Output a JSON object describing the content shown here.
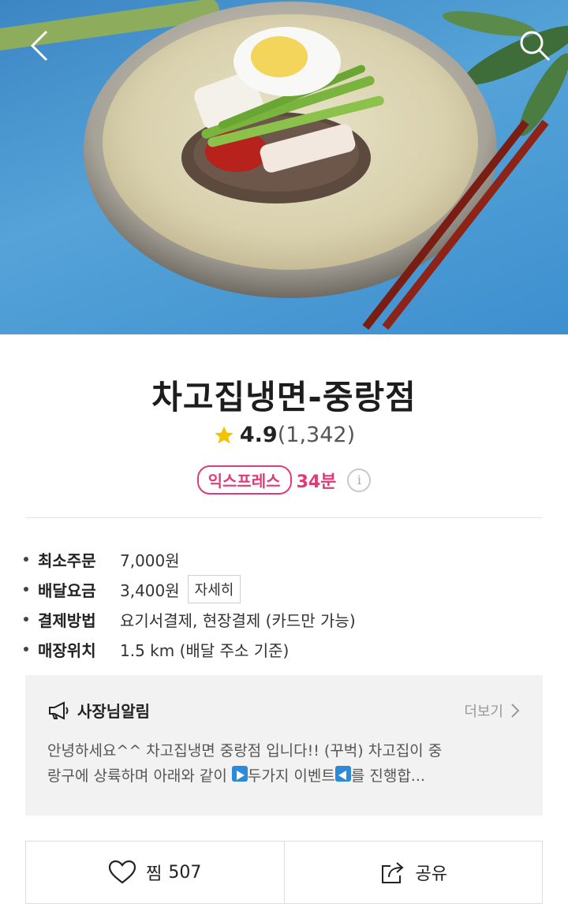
{
  "hero": {
    "image": "mul-naengmyeon-bowl-photo"
  },
  "nav": {
    "back_icon": "chevron-left-icon",
    "search_icon": "search-icon"
  },
  "store": {
    "name": "차고집냉면-중랑점",
    "rating": "4.9",
    "review_count": "(1,342)",
    "express_badge": "익스프레스",
    "delivery_time": "34분"
  },
  "info": [
    {
      "label": "최소주문",
      "value": "7,000원"
    },
    {
      "label": "배달요금",
      "value": "3,400원",
      "button": "자세히"
    },
    {
      "label": "결제방법",
      "value": "요기서결제, 현장결제 (카드만 가능)"
    },
    {
      "label": "매장위치",
      "value": "1.5 km (배달 주소 기준)"
    }
  ],
  "notice": {
    "title": "사장님알림",
    "more": "더보기",
    "line1": "안녕하세요^^ 차고집냉면 중랑점 입니다!! (꾸벅) 차고집이 중",
    "line2_a": "랑구에 상륙하며 아래와 같이 ",
    "line2_b": "두가지 이벤트",
    "line2_c": "를 진행합..."
  },
  "actions": {
    "like_label": "찜",
    "like_count": "507",
    "share_label": "공유"
  },
  "colors": {
    "accent": "#e03a79",
    "star": "#f5c200",
    "notice_bg": "#f2f2f2"
  }
}
